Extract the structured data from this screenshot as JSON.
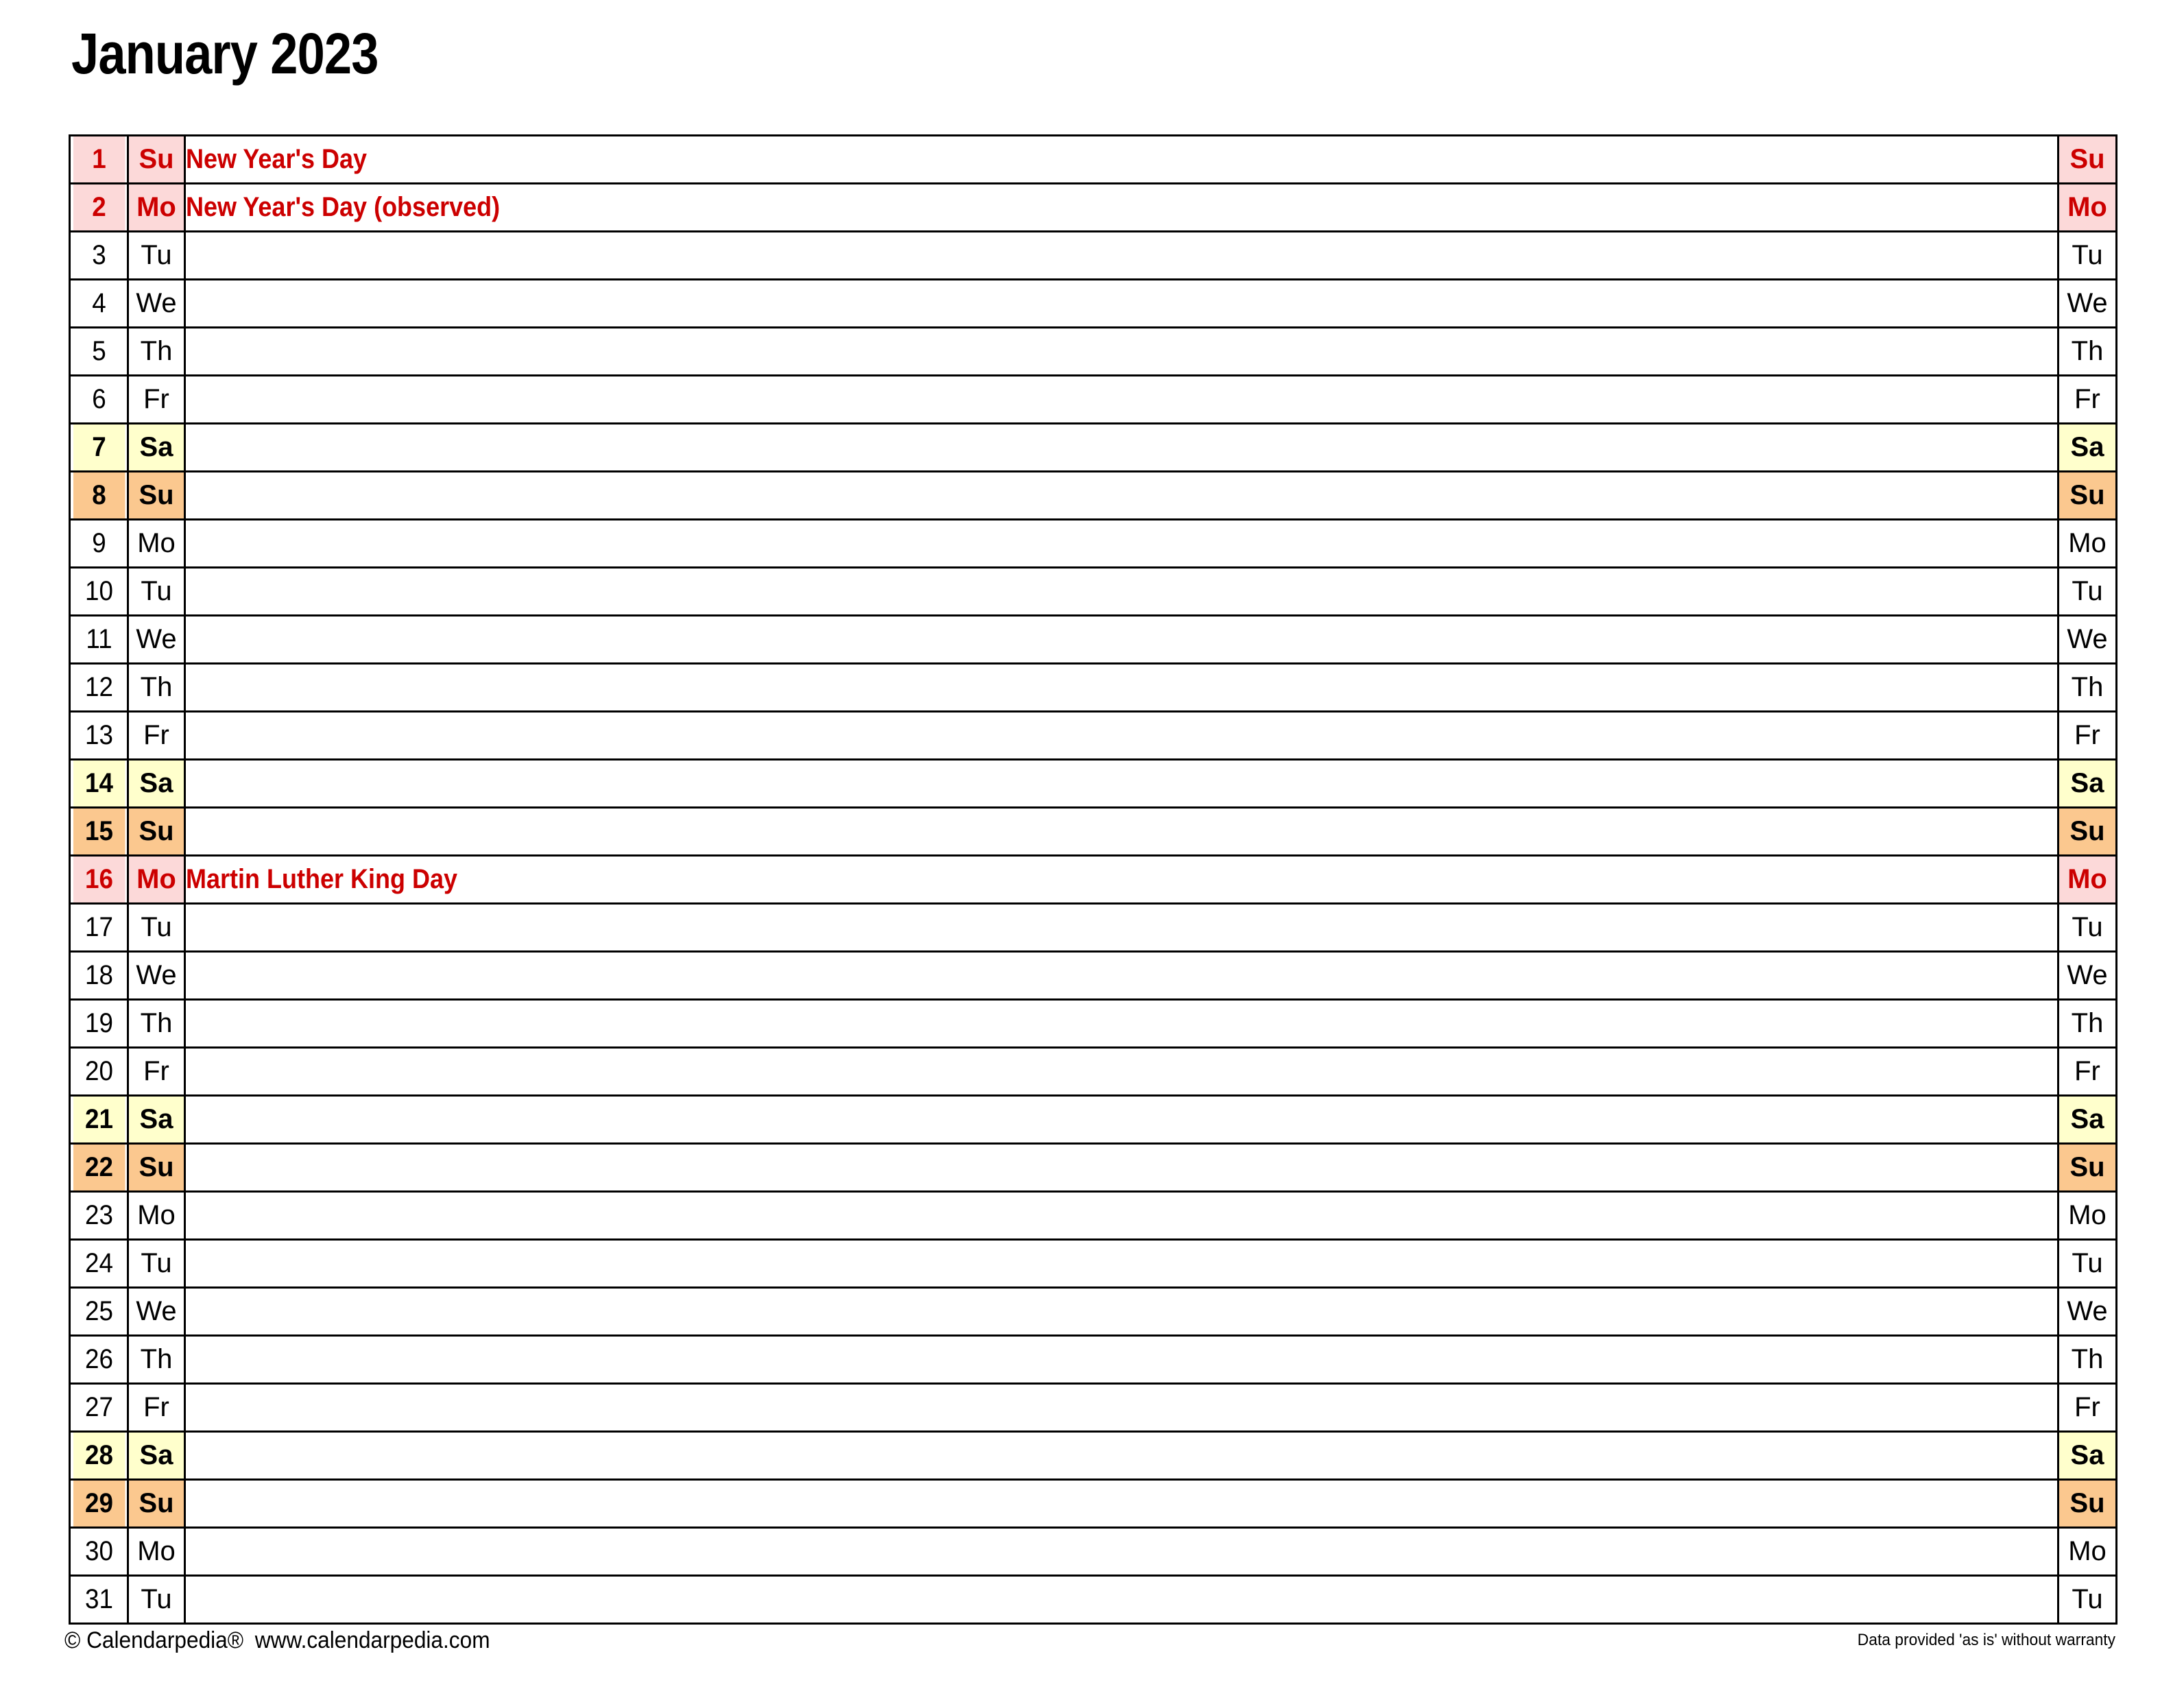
{
  "document": {
    "title": "January 2023",
    "month": "January",
    "year": "2023"
  },
  "colors": {
    "holiday_bg": "#FCD9D9",
    "holiday_text": "#CC0000",
    "saturday_bg": "#FFFFCC",
    "sunday_bg": "#FBC88F",
    "border": "#000000",
    "text": "#000000"
  },
  "table": {
    "columns": [
      "day-number",
      "day-abbreviation",
      "notes",
      "day-abbreviation-right"
    ],
    "rows": [
      {
        "day": "1",
        "abbr": "Su",
        "note": "New Year's Day",
        "type": "holiday"
      },
      {
        "day": "2",
        "abbr": "Mo",
        "note": "New Year's Day (observed)",
        "type": "holiday"
      },
      {
        "day": "3",
        "abbr": "Tu",
        "note": "",
        "type": "weekday"
      },
      {
        "day": "4",
        "abbr": "We",
        "note": "",
        "type": "weekday"
      },
      {
        "day": "5",
        "abbr": "Th",
        "note": "",
        "type": "weekday"
      },
      {
        "day": "6",
        "abbr": "Fr",
        "note": "",
        "type": "weekday"
      },
      {
        "day": "7",
        "abbr": "Sa",
        "note": "",
        "type": "saturday"
      },
      {
        "day": "8",
        "abbr": "Su",
        "note": "",
        "type": "sunday"
      },
      {
        "day": "9",
        "abbr": "Mo",
        "note": "",
        "type": "weekday"
      },
      {
        "day": "10",
        "abbr": "Tu",
        "note": "",
        "type": "weekday"
      },
      {
        "day": "11",
        "abbr": "We",
        "note": "",
        "type": "weekday"
      },
      {
        "day": "12",
        "abbr": "Th",
        "note": "",
        "type": "weekday"
      },
      {
        "day": "13",
        "abbr": "Fr",
        "note": "",
        "type": "weekday"
      },
      {
        "day": "14",
        "abbr": "Sa",
        "note": "",
        "type": "saturday"
      },
      {
        "day": "15",
        "abbr": "Su",
        "note": "",
        "type": "sunday"
      },
      {
        "day": "16",
        "abbr": "Mo",
        "note": "Martin Luther King Day",
        "type": "holiday"
      },
      {
        "day": "17",
        "abbr": "Tu",
        "note": "",
        "type": "weekday"
      },
      {
        "day": "18",
        "abbr": "We",
        "note": "",
        "type": "weekday"
      },
      {
        "day": "19",
        "abbr": "Th",
        "note": "",
        "type": "weekday"
      },
      {
        "day": "20",
        "abbr": "Fr",
        "note": "",
        "type": "weekday"
      },
      {
        "day": "21",
        "abbr": "Sa",
        "note": "",
        "type": "saturday"
      },
      {
        "day": "22",
        "abbr": "Su",
        "note": "",
        "type": "sunday"
      },
      {
        "day": "23",
        "abbr": "Mo",
        "note": "",
        "type": "weekday"
      },
      {
        "day": "24",
        "abbr": "Tu",
        "note": "",
        "type": "weekday"
      },
      {
        "day": "25",
        "abbr": "We",
        "note": "",
        "type": "weekday"
      },
      {
        "day": "26",
        "abbr": "Th",
        "note": "",
        "type": "weekday"
      },
      {
        "day": "27",
        "abbr": "Fr",
        "note": "",
        "type": "weekday"
      },
      {
        "day": "28",
        "abbr": "Sa",
        "note": "",
        "type": "saturday"
      },
      {
        "day": "29",
        "abbr": "Su",
        "note": "",
        "type": "sunday"
      },
      {
        "day": "30",
        "abbr": "Mo",
        "note": "",
        "type": "weekday"
      },
      {
        "day": "31",
        "abbr": "Tu",
        "note": "",
        "type": "weekday"
      }
    ]
  },
  "footer": {
    "copyright": "© Calendarpedia®",
    "website": "www.calendarpedia.com",
    "disclaimer": "Data provided 'as is' without warranty"
  }
}
